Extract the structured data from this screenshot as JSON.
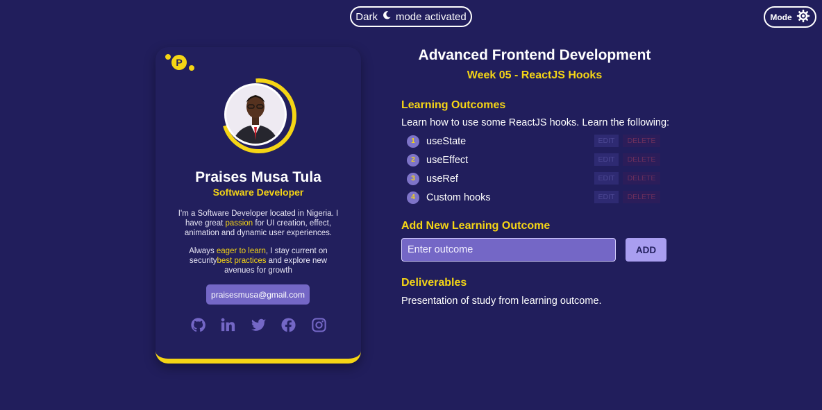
{
  "header": {
    "banner_before": "Dark",
    "banner_after": "mode activated",
    "banner_icon": "moon-icon",
    "mode_label": "Mode",
    "mode_icon": "sun-gear-icon"
  },
  "profile": {
    "logo_letter": "P",
    "name": "Praises Musa Tula",
    "role": "Software Developer",
    "bio1": {
      "a": "I'm a Software Developer located in Nigeria. I have great ",
      "b": "passion",
      "c": " for UI creation, effect, animation and dynamic user experiences."
    },
    "bio2": {
      "a": "Always ",
      "b": "eager to learn",
      "c": ", I stay current on security",
      "d": "best practices",
      "e": " and explore new avenues for growth"
    },
    "email": "praisesmusa@gmail.com",
    "socials": [
      "github-icon",
      "linkedin-icon",
      "twitter-icon",
      "facebook-icon",
      "instagram-icon"
    ]
  },
  "course": {
    "title": "Advanced Frontend Development",
    "subtitle": "Week 05 - ReactJS Hooks",
    "learning_heading": "Learning Outcomes",
    "intro": "Learn how to use some ReactJS hooks. Learn the following:",
    "outcomes": [
      {
        "num": "1",
        "label": "useState"
      },
      {
        "num": "2",
        "label": "useEffect"
      },
      {
        "num": "3",
        "label": "useRef"
      },
      {
        "num": "4",
        "label": "Custom hooks"
      }
    ],
    "edit_label": "EDIT",
    "delete_label": "DELETE",
    "add_heading": "Add New Learning Outcome",
    "input_placeholder": "Enter outcome",
    "add_label": "ADD",
    "deliverables_heading": "Deliverables",
    "deliverables_text": "Presentation of study from learning outcome."
  },
  "colors": {
    "background": "#211e5c",
    "accent_yellow": "#f5d515",
    "accent_purple": "#7467c6"
  }
}
